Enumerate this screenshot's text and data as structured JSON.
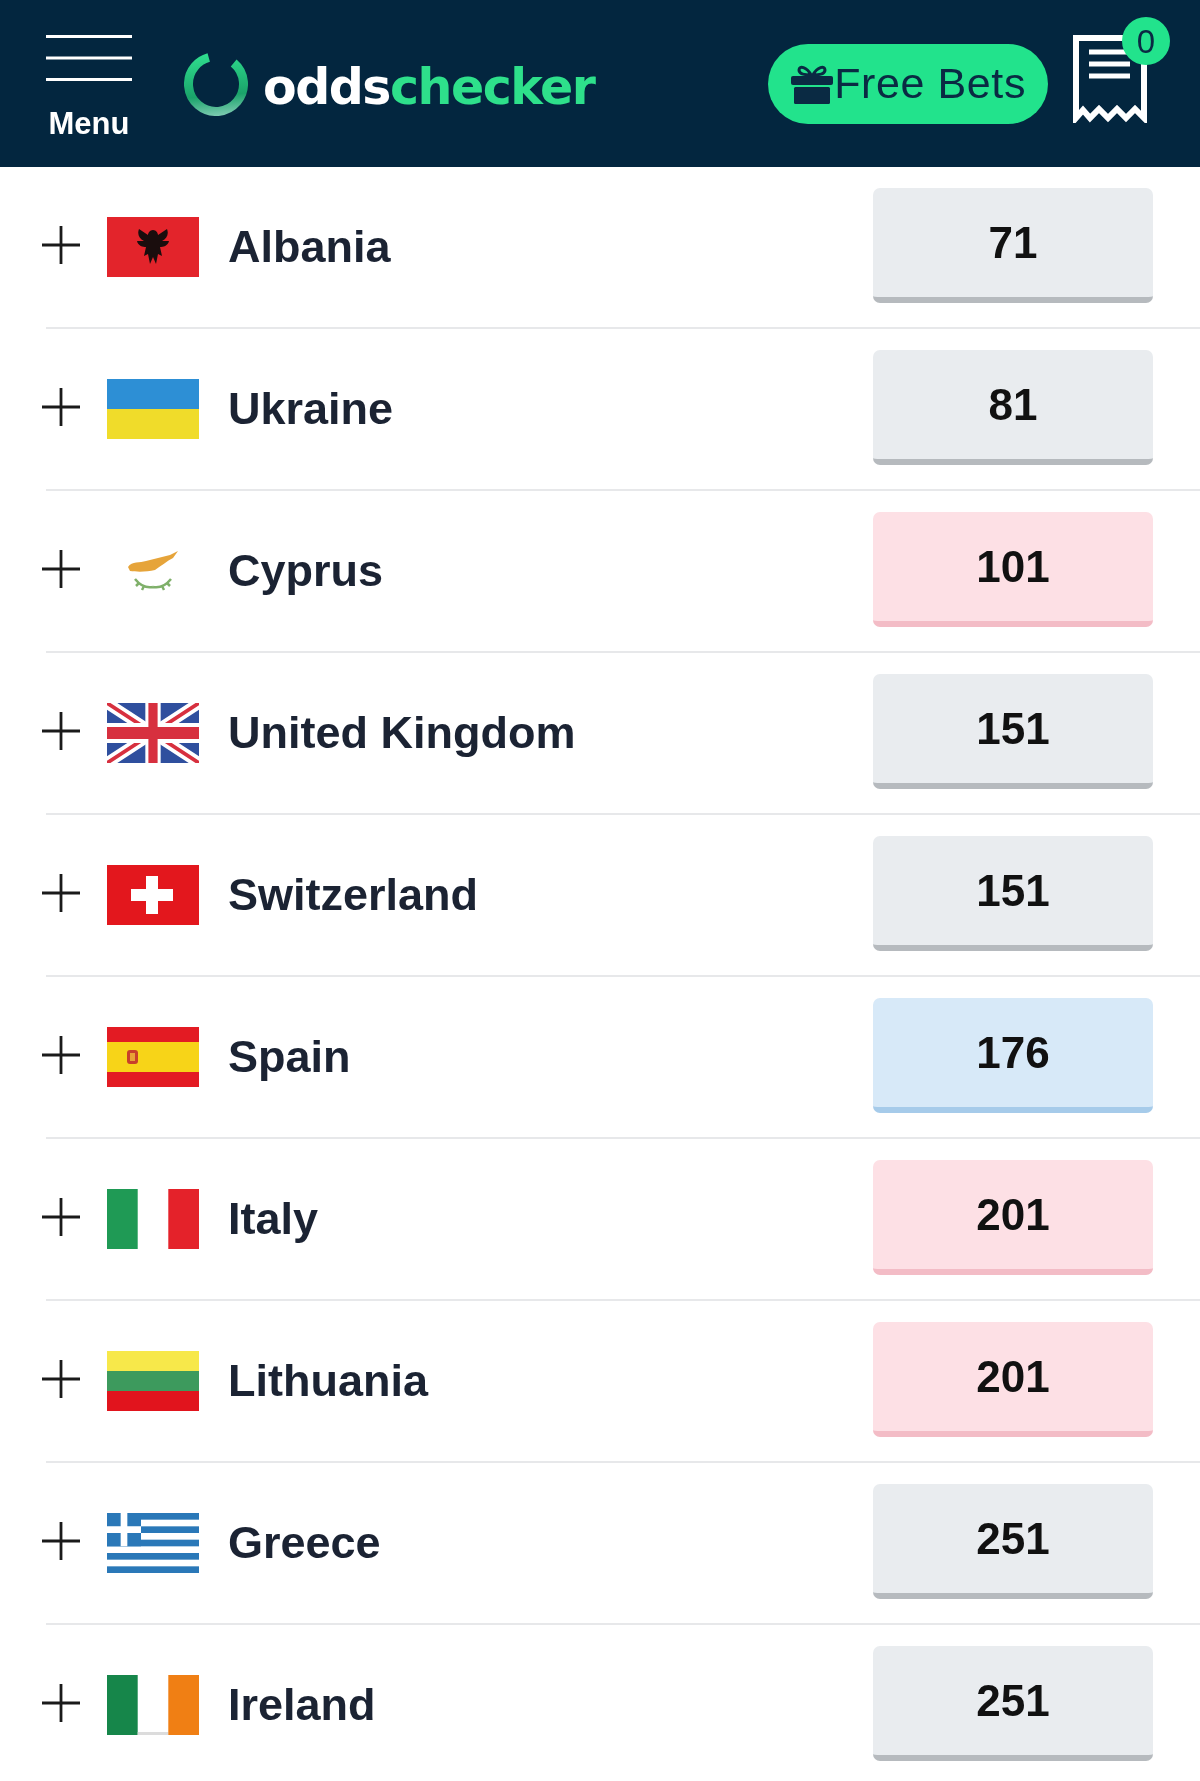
{
  "header": {
    "menu_label": "Menu",
    "logo": {
      "part_1": "odds",
      "part_2": "checker"
    },
    "free_bets": {
      "label": "Free Bets"
    },
    "betslip": {
      "count": "0"
    }
  },
  "rows": [
    {
      "name": "Albania",
      "flag": {
        "kind": "al"
      },
      "odds": "71",
      "drifting": false,
      "shortening": false,
      "expanded": false
    },
    {
      "name": "Ukraine",
      "flag": {
        "kind": "ua"
      },
      "odds": "81",
      "drifting": false,
      "shortening": false,
      "expanded": false
    },
    {
      "name": "Cyprus",
      "flag": {
        "kind": "cy"
      },
      "odds": "101",
      "drifting": true,
      "shortening": false,
      "expanded": false
    },
    {
      "name": "United Kingdom",
      "flag": {
        "kind": "gb"
      },
      "odds": "151",
      "drifting": false,
      "shortening": false,
      "expanded": false
    },
    {
      "name": "Switzerland",
      "flag": {
        "kind": "ch"
      },
      "odds": "151",
      "drifting": false,
      "shortening": false,
      "expanded": false
    },
    {
      "name": "Spain",
      "flag": {
        "kind": "es"
      },
      "odds": "176",
      "drifting": false,
      "shortening": true,
      "expanded": false
    },
    {
      "name": "Italy",
      "flag": {
        "kind": "it"
      },
      "odds": "201",
      "drifting": true,
      "shortening": false,
      "expanded": false
    },
    {
      "name": "Lithuania",
      "flag": {
        "kind": "lt"
      },
      "odds": "201",
      "drifting": true,
      "shortening": false,
      "expanded": false
    },
    {
      "name": "Greece",
      "flag": {
        "kind": "gr"
      },
      "odds": "251",
      "drifting": false,
      "shortening": false,
      "expanded": false
    },
    {
      "name": "Ireland",
      "flag": {
        "kind": "ie"
      },
      "odds": "251",
      "drifting": false,
      "shortening": false,
      "expanded": false
    }
  ]
}
